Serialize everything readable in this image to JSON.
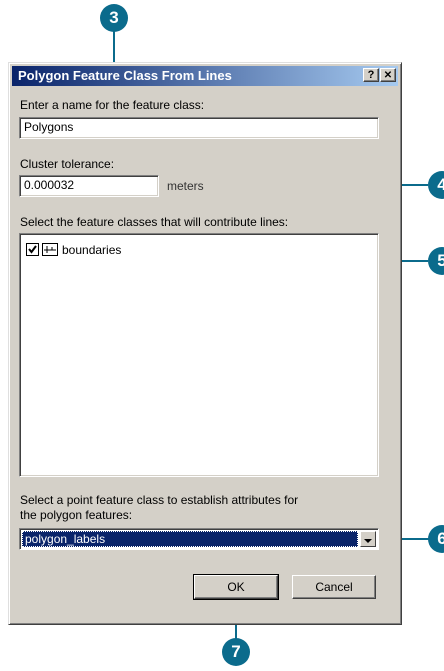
{
  "dialog": {
    "title": "Polygon Feature Class From Lines",
    "help_button": "?",
    "close_button": "✕"
  },
  "name_field": {
    "label": "Enter a name for the feature class:",
    "value": "Polygons"
  },
  "cluster": {
    "label": "Cluster tolerance:",
    "value": "0.000032",
    "unit": "meters"
  },
  "feature_classes": {
    "label": "Select the feature classes that will contribute lines:",
    "items": [
      {
        "name": "boundaries",
        "checked": true
      }
    ]
  },
  "point_class": {
    "label_line1": "Select a point feature class to establish attributes for",
    "label_line2": "the polygon features:",
    "selected": "polygon_labels"
  },
  "buttons": {
    "ok": "OK",
    "cancel": "Cancel"
  },
  "callouts": {
    "c3": "3",
    "c4": "4",
    "c5": "5",
    "c6": "6",
    "c7": "7"
  },
  "colors": {
    "callout": "#0b6b8c",
    "titlebar": "#0a246a",
    "dialog_bg": "#d4d0c8"
  }
}
